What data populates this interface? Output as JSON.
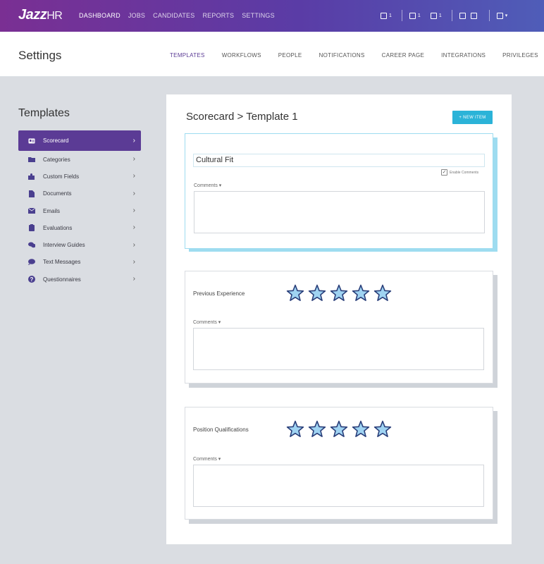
{
  "app": {
    "logo_main": "Jazz",
    "logo_sub": "HR",
    "nav": [
      "DASHBOARD",
      "JOBS",
      "CANDIDATES",
      "REPORTS",
      "SETTINGS"
    ],
    "icons": [
      {
        "name": "calendar-icon",
        "count": "1"
      },
      {
        "name": "chat-icon",
        "count": "1"
      },
      {
        "name": "bell-icon",
        "count": "1"
      },
      {
        "name": "help-icon",
        "count": ""
      },
      {
        "name": "grid-icon",
        "count": ""
      },
      {
        "name": "user-icon",
        "count": "▾"
      }
    ]
  },
  "header": {
    "title": "Settings",
    "tabs": [
      "TEMPLATES",
      "WORKFLOWS",
      "PEOPLE",
      "NOTIFICATIONS",
      "CAREER PAGE",
      "INTEGRATIONS",
      "PRIVILEGES"
    ]
  },
  "sidebar": {
    "title": "Templates",
    "items": [
      {
        "label": "Scorecard",
        "icon": "id-card-icon"
      },
      {
        "label": "Categories",
        "icon": "folder-icon"
      },
      {
        "label": "Custom Fields",
        "icon": "puzzle-icon"
      },
      {
        "label": "Documents",
        "icon": "document-icon"
      },
      {
        "label": "Emails",
        "icon": "envelope-icon"
      },
      {
        "label": "Evaluations",
        "icon": "clipboard-icon"
      },
      {
        "label": "Interview Guides",
        "icon": "comments-icon"
      },
      {
        "label": "Text Messages",
        "icon": "speech-bubble-icon"
      },
      {
        "label": "Questionnaires",
        "icon": "question-icon"
      }
    ]
  },
  "main": {
    "breadcrumb": "Scorecard > Template 1",
    "new_item": "+ NEW ITEM",
    "cards": [
      {
        "name": "Cultural Fit",
        "enable_comments": "Enable Comments",
        "comments_label": "Comments ▾"
      },
      {
        "name": "Previous Experience",
        "stars": 5,
        "comments_label": "Comments ▾"
      },
      {
        "name": "Position Qualifications",
        "stars": 5,
        "comments_label": "Comments ▾"
      }
    ]
  },
  "colors": {
    "brand_purple": "#5b3b95",
    "accent_blue": "#2bb3d8",
    "star_fill": "#9fd3f2",
    "star_stroke": "#2a3f7a"
  }
}
